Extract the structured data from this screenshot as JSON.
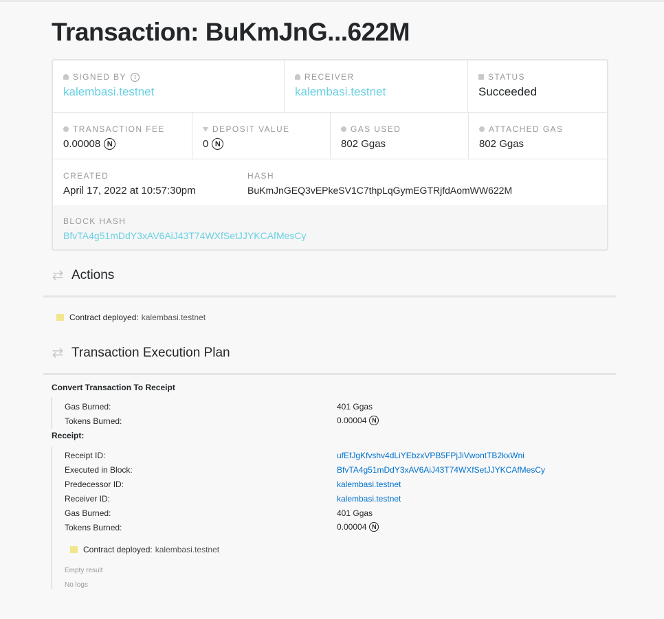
{
  "page": {
    "title": "Transaction: BuKmJnG...622M"
  },
  "summary": {
    "signed_by": {
      "label": "SIGNED BY",
      "value": "kalembasi.testnet"
    },
    "receiver": {
      "label": "RECEIVER",
      "value": "kalembasi.testnet"
    },
    "status": {
      "label": "STATUS",
      "value": "Succeeded"
    },
    "transaction_fee": {
      "label": "TRANSACTION FEE",
      "value": "0.00008",
      "unit": "N"
    },
    "deposit_value": {
      "label": "DEPOSIT VALUE",
      "value": "0",
      "unit": "N"
    },
    "gas_used": {
      "label": "GAS USED",
      "value": "802 Ggas"
    },
    "attached_gas": {
      "label": "ATTACHED GAS",
      "value": "802 Ggas"
    },
    "created": {
      "label": "CREATED",
      "value": "April 17, 2022 at 10:57:30pm"
    },
    "hash": {
      "label": "HASH",
      "value": "BuKmJnGEQ3vEPkeSV1C7thpLqGymEGTRjfdAomWW622M"
    },
    "block_hash": {
      "label": "BLOCK HASH",
      "value": "BfvTA4g51mDdY3xAV6AiJ43T74WXfSetJJYKCAfMesCy"
    }
  },
  "actions": {
    "heading": "Actions",
    "items": [
      {
        "label": "Contract deployed:",
        "value": "kalembasi.testnet"
      }
    ]
  },
  "execution_plan": {
    "heading": "Transaction Execution Plan",
    "convert": {
      "title": "Convert Transaction To Receipt",
      "gas_burned_label": "Gas Burned:",
      "gas_burned_value": "401 Ggas",
      "tokens_burned_label": "Tokens Burned:",
      "tokens_burned_value": "0.00004",
      "unit": "N"
    },
    "receipt": {
      "title": "Receipt:",
      "receipt_id_label": "Receipt ID:",
      "receipt_id_value": "ufEfJgKfvshv4dLiYEbzxVPB5FPjJiVwontTB2kxWni",
      "block_label": "Executed in Block:",
      "block_value": "BfvTA4g51mDdY3xAV6AiJ43T74WXfSetJJYKCAfMesCy",
      "predecessor_label": "Predecessor ID:",
      "predecessor_value": "kalembasi.testnet",
      "receiver_label": "Receiver ID:",
      "receiver_value": "kalembasi.testnet",
      "gas_burned_label": "Gas Burned:",
      "gas_burned_value": "401 Ggas",
      "tokens_burned_label": "Tokens Burned:",
      "tokens_burned_value": "0.00004",
      "unit": "N",
      "action_label": "Contract deployed:",
      "action_value": "kalembasi.testnet",
      "result": "Empty result",
      "logs": "No logs"
    }
  },
  "icons": [
    "person-icon",
    "info-icon",
    "chat-icon",
    "coin-icon",
    "funnel-icon",
    "swap-icon",
    "near-token-icon",
    "contract-icon"
  ],
  "colors": {
    "link_light": "#6ad1e3",
    "link": "#0072ce",
    "action_icon": "#f0e68c"
  }
}
